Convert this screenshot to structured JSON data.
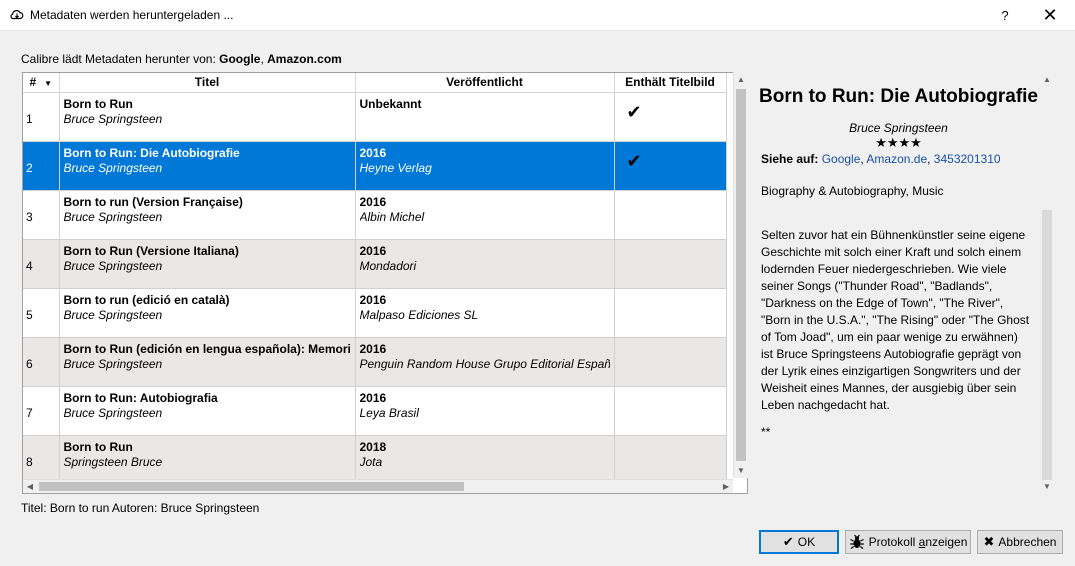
{
  "window": {
    "title": "Metadaten werden heruntergeladen ...",
    "app_icon": "cloud-download-icon",
    "help_label": "?",
    "close_glyph": "✕"
  },
  "source": {
    "prefix": "Calibre lädt Metadaten herunter von: ",
    "source1": "Google",
    "sep": ", ",
    "source2": "Amazon.com"
  },
  "table": {
    "headers": {
      "num": "#",
      "title": "Titel",
      "published": "Veröffentlicht",
      "cover": "Enthält Titelbild"
    },
    "rows": [
      {
        "num": "1",
        "title": "Born to Run",
        "author": "Bruce Springsteen",
        "year": "Unbekannt",
        "publisher": "",
        "cover": "✔"
      },
      {
        "num": "2",
        "title": "Born to Run: Die Autobiografie",
        "author": "Bruce Springsteen",
        "year": "2016",
        "publisher": "Heyne Verlag",
        "cover": "✔"
      },
      {
        "num": "3",
        "title": "Born to run (Version Française)",
        "author": "Bruce Springsteen",
        "year": "2016",
        "publisher": "Albin Michel",
        "cover": ""
      },
      {
        "num": "4",
        "title": "Born to Run (Versione Italiana)",
        "author": "Bruce Springsteen",
        "year": "2016",
        "publisher": "Mondadori",
        "cover": ""
      },
      {
        "num": "5",
        "title": "Born to run (edició en català)",
        "author": "Bruce Springsteen",
        "year": "2016",
        "publisher": "Malpaso Ediciones SL",
        "cover": ""
      },
      {
        "num": "6",
        "title": "Born to Run (edición en lengua española): Memorias",
        "author": "Bruce Springsteen",
        "year": "2016",
        "publisher": "Penguin Random House Grupo Editorial España",
        "cover": ""
      },
      {
        "num": "7",
        "title": "Born to Run: Autobiografia",
        "author": "Bruce Springsteen",
        "year": "2016",
        "publisher": "Leya Brasil",
        "cover": ""
      },
      {
        "num": "8",
        "title": "Born to Run",
        "author": "Springsteen Bruce",
        "year": "2018",
        "publisher": "Jota",
        "cover": ""
      }
    ],
    "selected_row": 2
  },
  "detail": {
    "title": "Born to Run: Die Autobiografie",
    "authors": "Bruce Springsteen",
    "stars": "★★★★",
    "see_on_label": "Siehe auf:",
    "links": [
      "Google",
      "Amazon.de",
      "3453201310"
    ],
    "tags": "Biography & Autobiography, Music",
    "comments": "Selten zuvor hat ein Bühnenkünstler seine eigene Geschichte mit solch einer Kraft und solch einem lodernden Feuer niedergeschrieben. Wie viele seiner Songs (\"Thunder Road\", \"Badlands\", \"Darkness on the Edge of Town\", \"The River\", \"Born in the U.S.A.\", \"The Rising\" oder \"The Ghost of Tom Joad\", um ein paar wenige zu erwähnen) ist Bruce Springsteens Autobiografie geprägt von der Lyrik eines einzigartigen Songwriters und der Weisheit eines Mannes, der ausgiebig über sein Leben nachgedacht hat.",
    "more": "**"
  },
  "status": {
    "text": "Titel: Born to run Autoren: Bruce Springsteen"
  },
  "buttons": {
    "ok": "OK",
    "ok_icon": "✔",
    "log_pre": "Protokoll ",
    "log_u": "a",
    "log_post": "nzeigen",
    "log_icon": "bug-icon",
    "cancel": "Abbrechen",
    "cancel_icon": "✖"
  }
}
